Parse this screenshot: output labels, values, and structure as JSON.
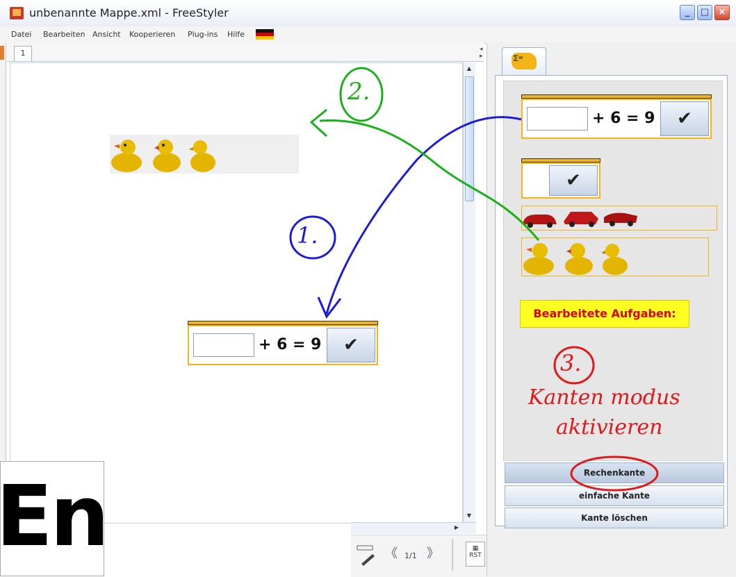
{
  "window": {
    "title": "unbenannte Mappe.xml - FreeStyler",
    "controls": {
      "minimize": "_",
      "maximize": "□",
      "close": "×"
    }
  },
  "menu": {
    "items": [
      "Datei",
      "Bearbeiten",
      "Ansicht",
      "Kooperieren",
      "Plug-ins",
      "Hilfe"
    ],
    "language_flag": "german-flag-icon"
  },
  "workspace": {
    "tab_label": "1"
  },
  "equation": {
    "operand": "+ 6 = 9",
    "input_value": "",
    "check_icon": "✔"
  },
  "annotations": {
    "step1": "1.",
    "step2": "2.",
    "step3": "3.",
    "step3_line1": "Kanten modus",
    "step3_line2": "aktivieren",
    "colors": {
      "step1": "#1a1adc",
      "step2": "#19b019",
      "step3": "#e01818"
    }
  },
  "logo": {
    "text": "En"
  },
  "toolbar": {
    "page_indicator": "1/1",
    "prev": "《",
    "next": "》",
    "plus": "+",
    "minus": "-"
  },
  "right_panel": {
    "tab_icon": "calculator-palette-icon",
    "label_processed": "Bearbeitete Aufgaben:",
    "buttons": {
      "rechenkante": "Rechenkante",
      "einfache_kante": "einfache Kante",
      "kante_loeschen": "Kante löschen"
    }
  }
}
